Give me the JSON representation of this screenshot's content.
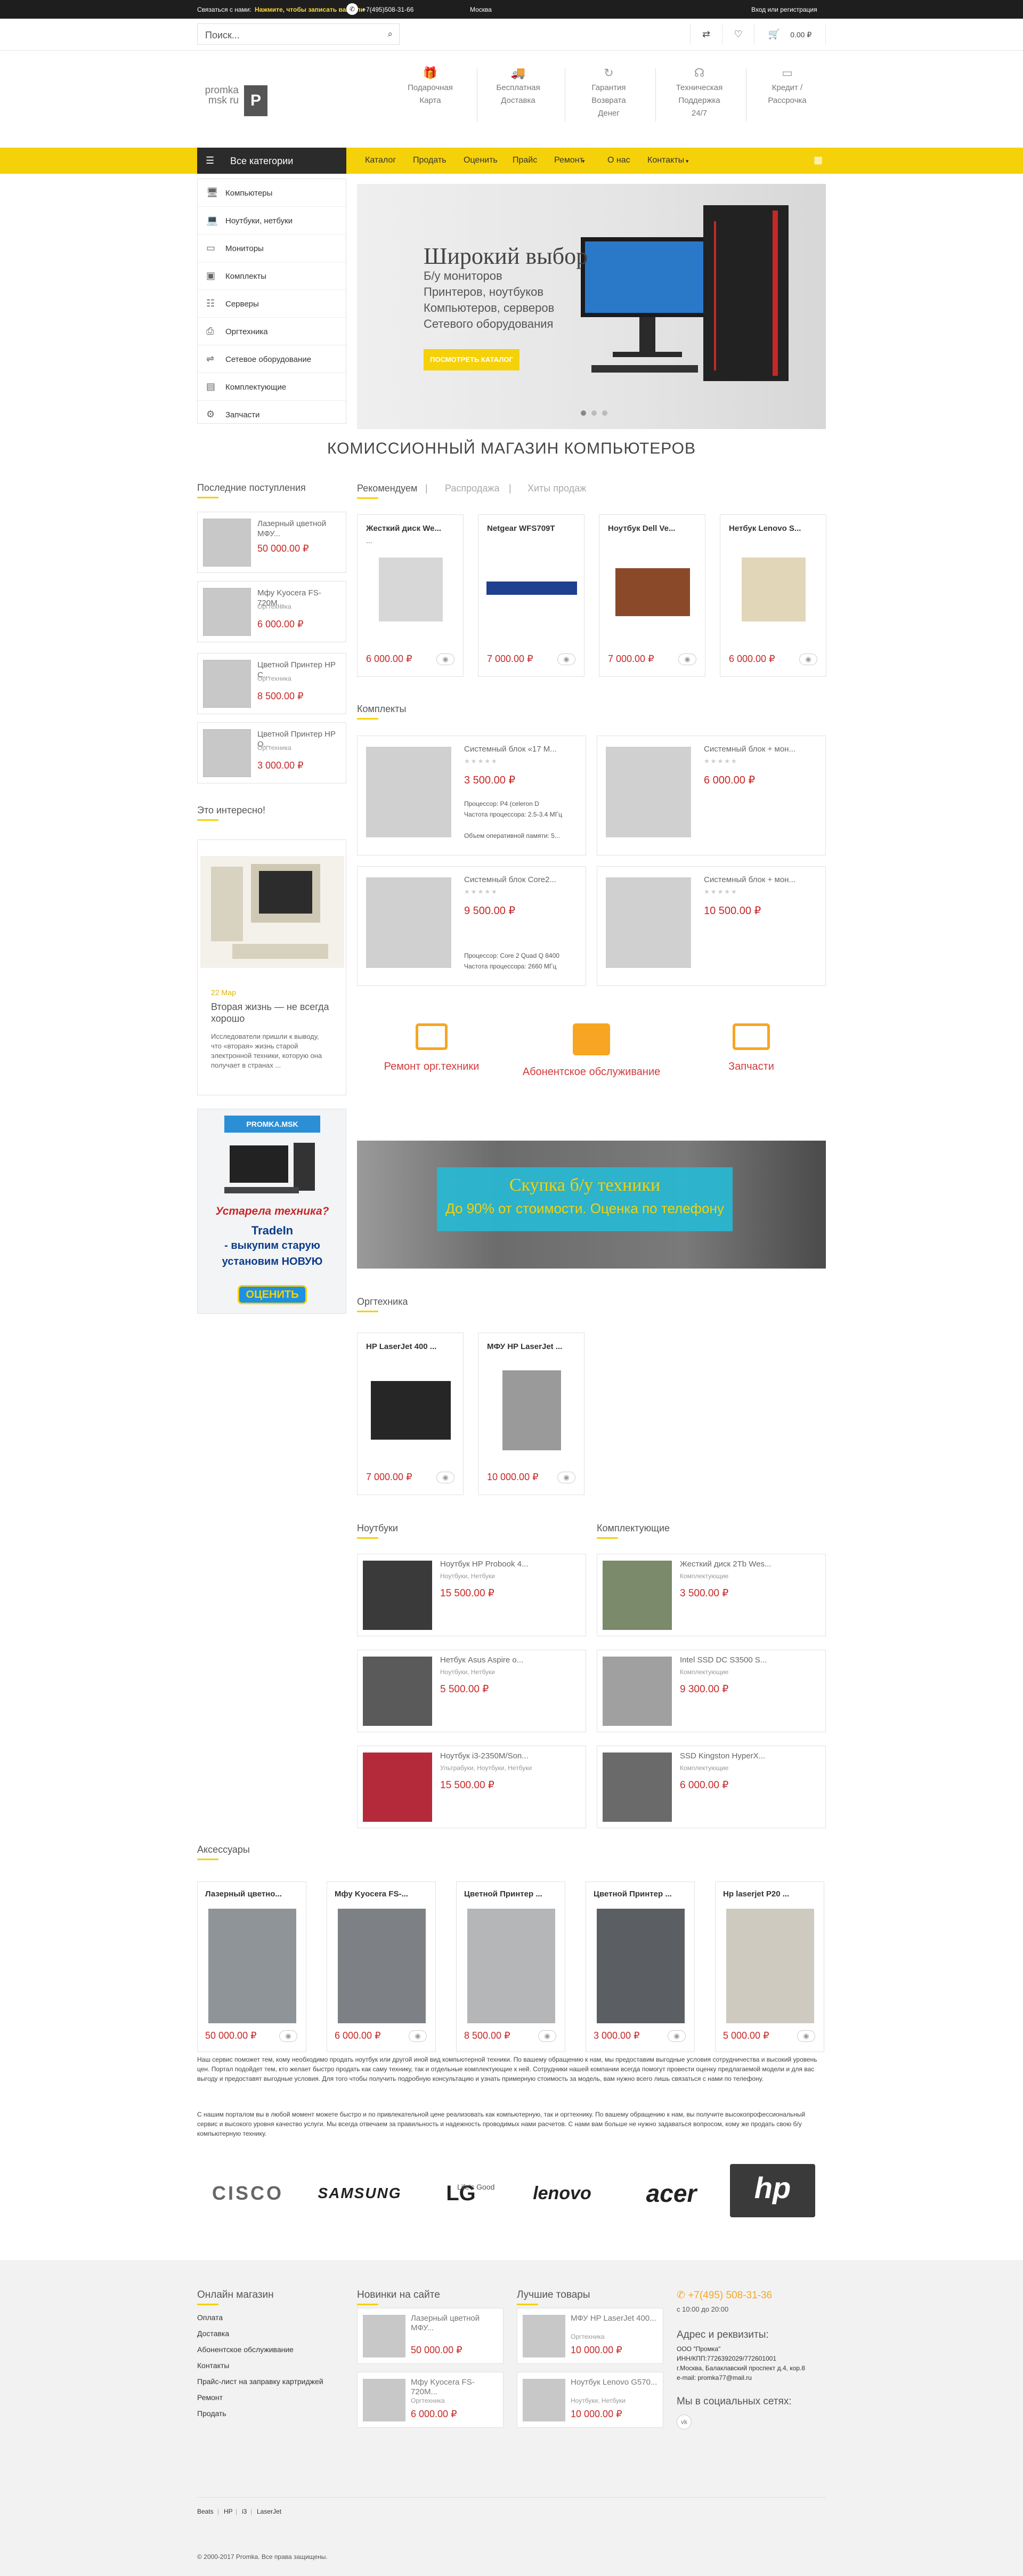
{
  "topbar": {
    "contact_prefix": "Связаться с нами:",
    "contact_highlight": "Нажмите, чтобы записать вам или",
    "phone": "+7(495)508-31-66",
    "city": "Москва",
    "login": "Вход или регистрация"
  },
  "search": {
    "placeholder": "Поиск..."
  },
  "cart": {
    "total": "0.00 ₽"
  },
  "logo": {
    "text": "promka msk ru"
  },
  "features": [
    {
      "icon": "gift-icon",
      "line1": "Подарочная",
      "line2": "Карта",
      "line3": ""
    },
    {
      "icon": "truck-icon",
      "line1": "Бесплатная",
      "line2": "Доставка",
      "line3": ""
    },
    {
      "icon": "refresh-icon",
      "line1": "Гарантия",
      "line2": "Возврата",
      "line3": "Денег"
    },
    {
      "icon": "headset-icon",
      "line1": "Техническая",
      "line2": "Поддержка",
      "line3": "24/7"
    },
    {
      "icon": "card-icon",
      "line1": "Кредит /",
      "line2": "Рассрочка",
      "line3": ""
    }
  ],
  "nav": {
    "all_categories": "Все категории",
    "menu": [
      "Каталог",
      "Продать",
      "Оценить",
      "Прайс",
      "Ремонт",
      "О нас",
      "Контакты"
    ]
  },
  "categories": [
    "Компьютеры",
    "Ноутбуки, нетбуки",
    "Мониторы",
    "Комплекты",
    "Серверы",
    "Оргтехника",
    "Сетевое оборудование",
    "Комплектующие",
    "Запчасти"
  ],
  "slider": {
    "title": "Широкий выбор",
    "lines": [
      "Б/у мониторов",
      "Принтеров, ноутбуков",
      "Компьютеров, серверов",
      "Сетевого оборудования"
    ],
    "button": "ПОСМОТРЕТЬ КАТАЛОГ"
  },
  "main_title": "КОМИССИОННЫЙ МАГАЗИН КОМПЬЮТЕРОВ",
  "recent": {
    "title": "Последние поступления",
    "items": [
      {
        "name": "Лазерный цветной МФУ...",
        "category": "",
        "price": "50 000.00 ₽"
      },
      {
        "name": "Мфу Kyocera FS-720M...",
        "category": "Оргтехника",
        "price": "6 000.00 ₽"
      },
      {
        "name": "Цветной Принтер HP C...",
        "category": "Оргтехника",
        "price": "8 500.00 ₽"
      },
      {
        "name": "Цветной Принтер HP O...",
        "category": "Оргтехника",
        "price": "3 000.00 ₽"
      }
    ]
  },
  "interesting": {
    "title": "Это интересно!",
    "date": "22 Мар",
    "headline": "Вторая жизнь — не всегда хорошо",
    "text": "Исследователи пришли к выводу, что «вторая» жизнь старой электронной техники, которую она получает в странах ..."
  },
  "ad": {
    "brand": "PROMKA.MSK",
    "tagline": "Устарела техника?",
    "line1": "TradeIn",
    "line2": "- выкупим старую",
    "line3": "установим НОВУЮ",
    "button": "ОЦЕНИТЬ"
  },
  "tabs": [
    "Рекомендуем",
    "Распродажа",
    "Хиты продаж"
  ],
  "featured": [
    {
      "name": "Жесткий диск We...",
      "price": "6 000.00 ₽"
    },
    {
      "name": "Netgear WFS709T",
      "price": "7 000.00 ₽"
    },
    {
      "name": "Ноутбук Dell Ve...",
      "price": "7 000.00 ₽"
    },
    {
      "name": "Нетбук Lenovo S...",
      "price": "6 000.00 ₽"
    }
  ],
  "kits": {
    "title": "Комплекты",
    "items": [
      {
        "name": "Системный блок «17 М...",
        "price": "3 500.00 ₽",
        "specs": [
          "Процессор: P4 (celeron D",
          "Частота процессора: 2.5-3.4 МГц",
          "Объем оперативной памяти: 5..."
        ]
      },
      {
        "name": "Системный блок + мон...",
        "price": "6 000.00 ₽",
        "specs": []
      },
      {
        "name": "Системный блок Core2...",
        "price": "9 500.00 ₽",
        "specs": [
          "Процессор: Core 2 Quad Q 8400",
          "Частота процессора: 2660 МГц"
        ]
      },
      {
        "name": "Системный блок + мон...",
        "price": "10 500.00 ₽",
        "specs": []
      }
    ]
  },
  "services": [
    "Ремонт орг.техники",
    "Абонентское обслуживание",
    "Запчасти"
  ],
  "buyback": {
    "title": "Скупка б/у техники",
    "subtitle": "До 90% от стоимости. Оценка по телефону"
  },
  "office": {
    "title": "Оргтехника",
    "items": [
      {
        "name": "HP LaserJet 400 ...",
        "price": "7 000.00 ₽"
      },
      {
        "name": "МФУ HP LaserJet ...",
        "price": "10 000.00 ₽"
      }
    ]
  },
  "laptops": {
    "title": "Ноутбуки",
    "items": [
      {
        "name": "Ноутбук HP Probook 4...",
        "category": "Ноутбуки, Нетбуки",
        "price": "15 500.00 ₽"
      },
      {
        "name": "Нетбук Asus Aspire o...",
        "category": "Ноутбуки, Нетбуки",
        "price": "5 500.00 ₽"
      },
      {
        "name": "Ноутбук i3-2350M/Son...",
        "category": "Ультрабуки, Ноутбуки, Нетбуки",
        "price": "15 500.00 ₽"
      }
    ]
  },
  "parts": {
    "title": "Комплектующие",
    "items": [
      {
        "name": "Жесткий диск 2Tb Wes...",
        "category": "Комплектующие",
        "price": "3 500.00 ₽"
      },
      {
        "name": "Intel SSD DC S3500 S...",
        "category": "Комплектующие",
        "price": "9 300.00 ₽"
      },
      {
        "name": "SSD Kingston HyperX...",
        "category": "Комплектующие",
        "price": "6 000.00 ₽"
      }
    ]
  },
  "accessories": {
    "title": "Аксессуары",
    "items": [
      {
        "name": "Лазерный цветно...",
        "price": "50 000.00 ₽"
      },
      {
        "name": "Мфу Kyocera FS-...",
        "price": "6 000.00 ₽"
      },
      {
        "name": "Цветной Принтер ...",
        "price": "8 500.00 ₽"
      },
      {
        "name": "Цветной Принтер ...",
        "price": "3 000.00 ₽"
      },
      {
        "name": "Hp laserjet P20 ...",
        "price": "5 000.00 ₽"
      }
    ]
  },
  "about": {
    "p1": "Наш сервис поможет тем, кому необходимо продать ноутбук или другой иной вид компьютерной техники. По вашему обращению к нам, мы предоставим выгодные условия сотрудничества и высокий уровень цен. Портал подойдет тем, кто желает быстро продать как саму технику, так и отдельные комплектующие к ней. Сотрудники нашей компании всегда помогут провести оценку предлагаемой модели и для вас выгоду и предоставят выгодные условия. Для того чтобы получить подробную консультацию и узнать примерную стоимость за модель, вам нужно всего лишь связаться с нами по телефону.",
    "p2": "С нашим порталом вы в любой момент можете быстро и по привлекательной цене реализовать как компьютерную, так и оргтехнику. По вашему обращению к нам, вы получите высокопрофессиональный сервис и высокого уровня качество услуги. Мы всегда отвечаем за правильность и надежность проводимых нами расчетов. С нами вам больше не нужно задаваться вопросом, кому же продать свою б/у компьютерную технику."
  },
  "brands": [
    "CISCO",
    "SAMSUNG",
    "LG",
    "lenovo",
    "acer",
    "hp"
  ],
  "brand_lg_slogan": "Life's Good",
  "footer": {
    "shop_title": "Онлайн магазин",
    "shop_links": [
      "Оплата",
      "Доставка",
      "Абонентское обслуживание",
      "Контакты",
      "Прайс-лист на заправку картриджей",
      "Ремонт",
      "Продать"
    ],
    "new_title": "Новинки на сайте",
    "new_items": [
      {
        "name": "Лазерный цветной МФУ...",
        "category": "",
        "price": "50 000.00 ₽"
      },
      {
        "name": "Мфу Kyocera FS-720M...",
        "category": "Оргтехника",
        "price": "6 000.00 ₽"
      }
    ],
    "best_title": "Лучшие товары",
    "best_items": [
      {
        "name": "МФУ HP LaserJet 400...",
        "category": "Оргтехника",
        "price": "10 000.00 ₽"
      },
      {
        "name": "Ноутбук Lenovo G570...",
        "category": "Ноутбуки, Нетбуки",
        "price": "10 000.00 ₽"
      }
    ],
    "phone": "+7(495) 508-31-36",
    "hours": "с 10:00 до 20:00",
    "req_title": "Адрес и реквизиты:",
    "req_lines": [
      "ООО \"Промка\"",
      "ИНН/КПП:7726392029/772601001",
      "г.Москва, Балаклавский проспект д.4, кор.8",
      "e-mail: promka77@mail.ru"
    ],
    "social_title": "Мы в социальных сетях:",
    "tags": [
      "Beats",
      "HP",
      "i3",
      "LaserJet"
    ],
    "copyright": "© 2000-2017 Promka. Все права защищены."
  }
}
